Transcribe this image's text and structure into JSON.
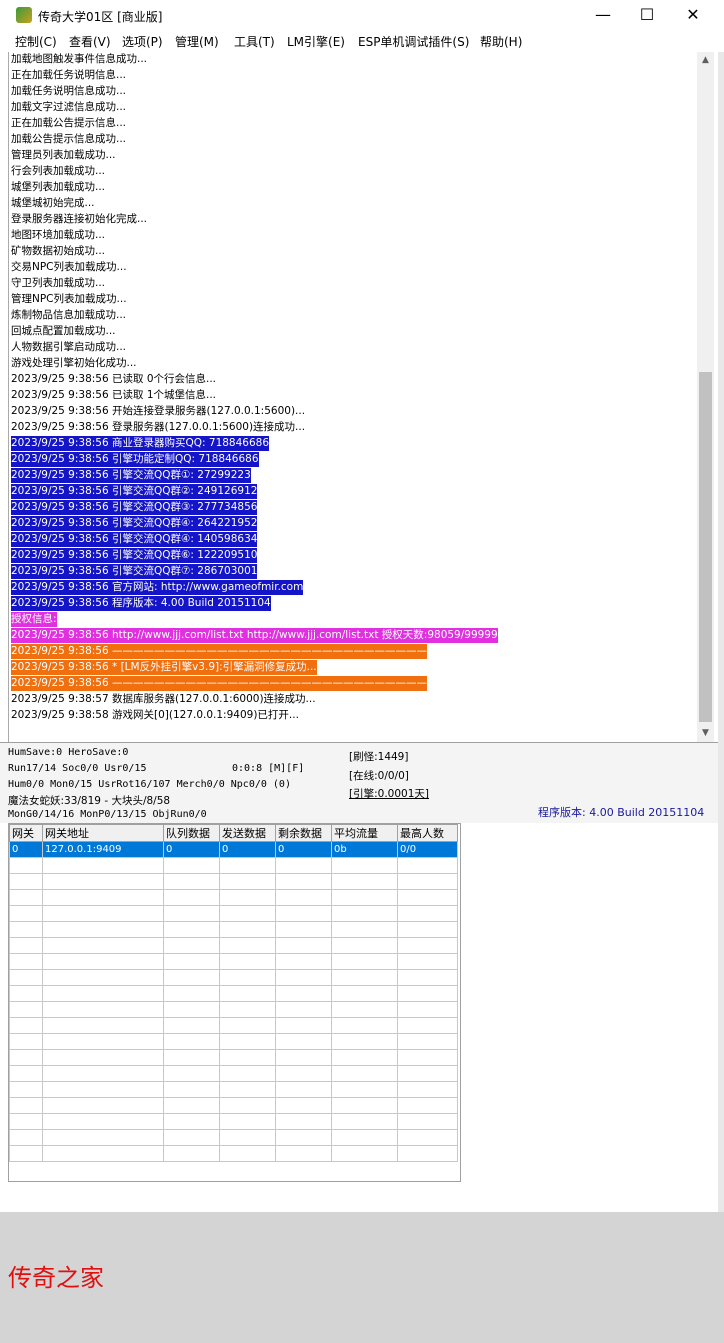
{
  "window": {
    "title": "传奇大学01区 [商业版]",
    "minimize": "—",
    "maximize": "☐",
    "close": "✕"
  },
  "menu": [
    "控制(C)",
    "查看(V)",
    "选项(P)",
    "管理(M)",
    "工具(T)",
    "LM引擎(E)",
    "ESP单机调试插件(S)",
    "帮助(H)"
  ],
  "log_lines": [
    {
      "text": "加载地图触发事件信息成功...",
      "style": "plain"
    },
    {
      "text": "正在加载任务说明信息...",
      "style": "plain"
    },
    {
      "text": "加载任务说明信息成功...",
      "style": "plain"
    },
    {
      "text": "加载文字过滤信息成功...",
      "style": "plain"
    },
    {
      "text": "正在加载公告提示信息...",
      "style": "plain"
    },
    {
      "text": "加载公告提示信息成功...",
      "style": "plain"
    },
    {
      "text": "管理员列表加载成功...",
      "style": "plain"
    },
    {
      "text": "行会列表加载成功...",
      "style": "plain"
    },
    {
      "text": "城堡列表加载成功...",
      "style": "plain"
    },
    {
      "text": "城堡城初始完成...",
      "style": "plain"
    },
    {
      "text": "登录服务器连接初始化完成...",
      "style": "plain"
    },
    {
      "text": "地图环境加载成功...",
      "style": "plain"
    },
    {
      "text": "矿物数据初始成功...",
      "style": "plain"
    },
    {
      "text": "交易NPC列表加载成功...",
      "style": "plain"
    },
    {
      "text": "守卫列表加载成功...",
      "style": "plain"
    },
    {
      "text": "管理NPC列表加载成功...",
      "style": "plain"
    },
    {
      "text": "炼制物品信息加载成功...",
      "style": "plain"
    },
    {
      "text": "回城点配置加载成功...",
      "style": "plain"
    },
    {
      "text": "人物数据引擎启动成功...",
      "style": "plain"
    },
    {
      "text": "游戏处理引擎初始化成功...",
      "style": "plain"
    },
    {
      "text": "2023/9/25 9:38:56 已读取 0个行会信息...",
      "style": "plain"
    },
    {
      "text": "2023/9/25 9:38:56 已读取 1个城堡信息...",
      "style": "plain"
    },
    {
      "text": "2023/9/25 9:38:56 开始连接登录服务器(127.0.0.1:5600)...",
      "style": "plain"
    },
    {
      "text": "2023/9/25 9:38:56 登录服务器(127.0.0.1:5600)连接成功...",
      "style": "plain"
    },
    {
      "text": "2023/9/25 9:38:56 商业登录器购买QQ: 718846686",
      "style": "sel"
    },
    {
      "text": "2023/9/25 9:38:56 引擎功能定制QQ: 718846686",
      "style": "sel"
    },
    {
      "text": "2023/9/25 9:38:56 引擎交流QQ群①: 27299223",
      "style": "sel"
    },
    {
      "text": "2023/9/25 9:38:56 引擎交流QQ群②: 249126912",
      "style": "sel"
    },
    {
      "text": "2023/9/25 9:38:56 引擎交流QQ群③: 277734856",
      "style": "sel"
    },
    {
      "text": "2023/9/25 9:38:56 引擎交流QQ群④: 264221952",
      "style": "sel"
    },
    {
      "text": "2023/9/25 9:38:56 引擎交流QQ群④: 140598634",
      "style": "sel"
    },
    {
      "text": "2023/9/25 9:38:56 引擎交流QQ群⑥: 122209510",
      "style": "sel"
    },
    {
      "text": "2023/9/25 9:38:56 引擎交流QQ群⑦: 286703001",
      "style": "sel"
    },
    {
      "text": "2023/9/25 9:38:56 官方网站: http://www.gameofmir.com",
      "style": "sel"
    },
    {
      "text": "2023/9/25 9:38:56 程序版本: 4.00 Build 20151104",
      "style": "sel"
    },
    {
      "text": "授权信息:",
      "style": "mag"
    },
    {
      "text": "2023/9/25 9:38:56 http://www.jjj.com/list.txt http://www.jjj.com/list.txt 授权天数:98059/99999",
      "style": "mag"
    },
    {
      "text": "2023/9/25 9:38:56 ——————————————————————————————",
      "style": "org"
    },
    {
      "text": "2023/9/25 9:38:56 * [LM反外挂引擎v3.9]:引擎漏洞修复成功...",
      "style": "org"
    },
    {
      "text": "2023/9/25 9:38:56 ——————————————————————————————",
      "style": "org"
    },
    {
      "text": "2023/9/25 9:38:57 数据库服务器(127.0.0.1:6000)连接成功...",
      "style": "plain"
    },
    {
      "text": "2023/9/25 9:38:58 游戏网关[0](127.0.0.1:9409)已打开...",
      "style": "plain"
    }
  ],
  "status": {
    "humsave": "HumSave:0 HeroSave:0",
    "run": "Run17/14 Soc0/0 Usr0/15",
    "timer": "0:0:8 [M][F]",
    "hum": "Hum0/0 Mon0/15 UsrRot16/107 Merch0/0 Npc0/0 (0)",
    "monster": "魔法女蛇妖:33/819 - 大块头/8/58",
    "mong": "MonG0/14/16 MonP0/13/15 ObjRun0/0",
    "refresh": "[刷怪:1449]",
    "online": "[在线:0/0/0]",
    "engine": "[引擎:0.0001天]",
    "version": "程序版本: 4.00 Build 20151104"
  },
  "gateway_table": {
    "headers": [
      "网关",
      "网关地址",
      "队列数据",
      "发送数据",
      "剩余数据",
      "平均流量",
      "最高人数"
    ],
    "rows": [
      [
        "0",
        "127.0.0.1:9409",
        "0",
        "0",
        "0",
        "0b",
        "0/0"
      ]
    ]
  },
  "watermark": "传奇之家",
  "colors": {
    "selection_blue": "#1414c8",
    "magenta": "#e030e0",
    "orange": "#f07010",
    "row_select": "#0078d7",
    "watermark_red": "#e01010"
  }
}
